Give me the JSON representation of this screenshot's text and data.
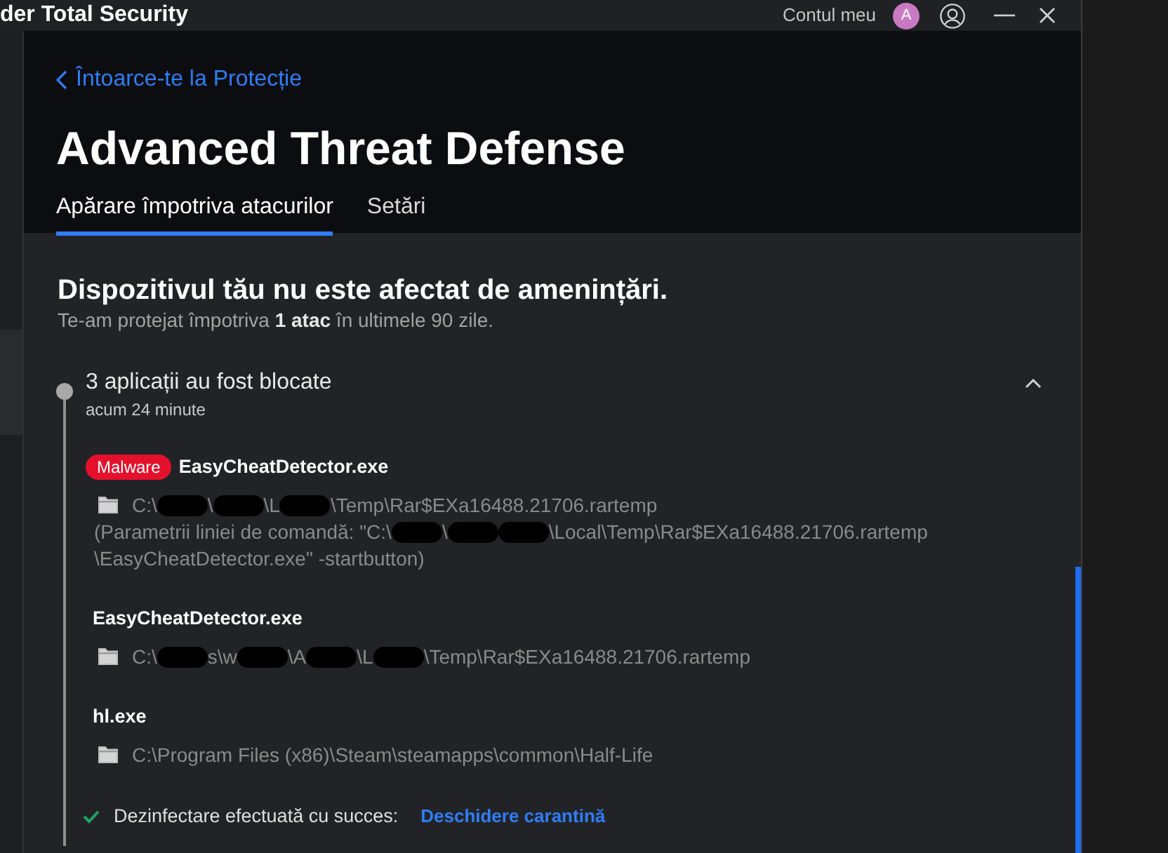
{
  "title_bar": {
    "app_name": "der Total Security",
    "account_label": "Contul meu",
    "avatar_initial": "A"
  },
  "header": {
    "back_link": "Întoarce-te la Protecție",
    "title": "Advanced Threat Defense",
    "tabs": [
      {
        "label": "Apărare împotriva atacurilor",
        "selected": true
      },
      {
        "label": "Setări",
        "selected": false
      }
    ]
  },
  "status": {
    "heading": "Dispozitivul tău nu este afectat de amenințări.",
    "summary": "Te-am protejat împotriva **1 atac** în ultimele 90 zile."
  },
  "event": {
    "title": "3 aplicații au fost blocate",
    "time": "acum 24 minute",
    "expanded": true,
    "apps": [
      {
        "badge": "Malware",
        "name": "EasyCheatDetector.exe",
        "path": [
          {
            "kind": "text",
            "text": "C:\\"
          },
          {
            "kind": "redacted"
          },
          {
            "kind": "text",
            "text": "\\"
          },
          {
            "kind": "redacted"
          },
          {
            "kind": "text",
            "text": "\\L"
          },
          {
            "kind": "redacted"
          },
          {
            "kind": "text",
            "text": "\\Temp\\Rar$EXa16488.21706.rartemp"
          }
        ],
        "command_lines": [
          [
            {
              "kind": "text",
              "text": "(Parametrii liniei de comandă: \"C:\\"
            },
            {
              "kind": "redacted"
            },
            {
              "kind": "text",
              "text": "\\"
            },
            {
              "kind": "redacted"
            },
            {
              "kind": "redacted"
            },
            {
              "kind": "text",
              "text": "\\Local\\Temp\\Rar$EXa16488.21706.rartemp"
            }
          ],
          [
            {
              "kind": "text",
              "text": "\\EasyCheatDetector.exe\" -startbutton)"
            }
          ]
        ]
      },
      {
        "name": "EasyCheatDetector.exe",
        "path": [
          {
            "kind": "text",
            "text": "C:\\"
          },
          {
            "kind": "redacted"
          },
          {
            "kind": "text",
            "text": "s\\w"
          },
          {
            "kind": "redacted"
          },
          {
            "kind": "text",
            "text": "\\A"
          },
          {
            "kind": "redacted"
          },
          {
            "kind": "text",
            "text": "\\L"
          },
          {
            "kind": "redacted"
          },
          {
            "kind": "text",
            "text": "\\Temp\\Rar$EXa16488.21706.rartemp"
          }
        ]
      },
      {
        "name": "hl.exe",
        "path": [
          {
            "kind": "text",
            "text": "C:\\Program Files (x86)\\Steam\\steamapps\\common\\Half-Life"
          }
        ]
      }
    ],
    "result": {
      "message": "Dezinfectare efectuată cu succes:",
      "link": "Deschidere carantină"
    }
  }
}
